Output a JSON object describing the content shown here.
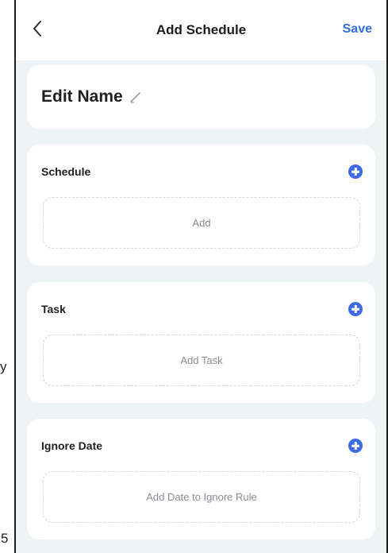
{
  "stray_marks": {
    "left_y": "y",
    "left_5": "5"
  },
  "header": {
    "title": "Add Schedule",
    "save_label": "Save",
    "back_icon": "chevron-left-icon"
  },
  "name_card": {
    "name": "Edit Name",
    "edit_icon": "pencil-icon"
  },
  "sections": {
    "schedule": {
      "title": "Schedule",
      "action": "Add"
    },
    "task": {
      "title": "Task",
      "action": "Add Task"
    },
    "ignore": {
      "title": "Ignore Date",
      "action": "Add Date to Ignore Rule"
    }
  },
  "colors": {
    "accent": "#2f6fe0",
    "plus": "#3b69e8",
    "background": "#eef3f6",
    "card": "#ffffff"
  }
}
